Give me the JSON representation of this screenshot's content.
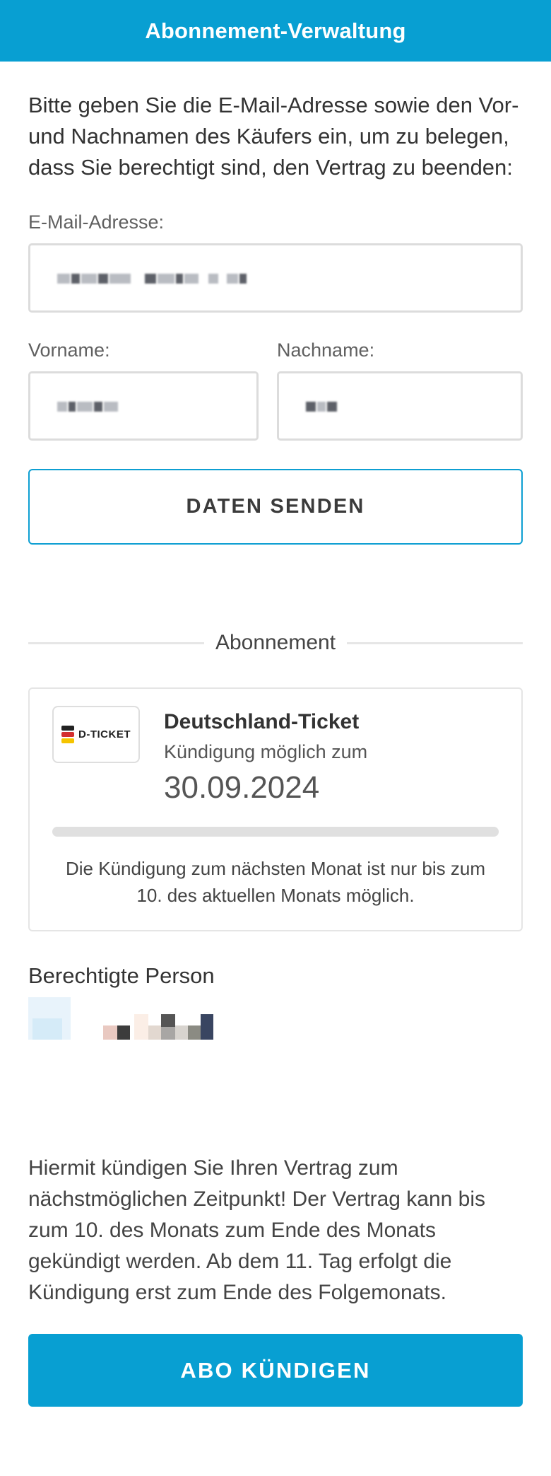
{
  "header": {
    "title": "Abonnement-Verwaltung"
  },
  "intro": "Bitte geben Sie die E-Mail-Adresse sowie den Vor- und Nachnamen des Käufers ein, um zu belegen, dass Sie berechtigt sind, den Vertrag zu beenden:",
  "form": {
    "email_label": "E-Mail-Adresse:",
    "firstname_label": "Vorname:",
    "lastname_label": "Nachname:",
    "submit_label": "DATEN SENDEN"
  },
  "subscription": {
    "section_label": "Abonnement",
    "logo_text": "D-TICKET",
    "logo_colors": [
      "#222222",
      "#d32f2f",
      "#f5c400"
    ],
    "title": "Deutschland-Ticket",
    "cancel_possible_label": "Kündigung möglich zum",
    "cancel_date": "30.09.2024",
    "progress_fraction": 0,
    "note": "Die Kündigung zum nächsten Monat ist nur bis zum 10. des aktuellen Monats möglich."
  },
  "person": {
    "title": "Berechtigte Person"
  },
  "final_text": "Hiermit kündigen Sie Ihren Vertrag zum nächstmöglichen Zeitpunkt! Der Vertrag kann bis zum 10. des Monats zum Ende des Monats gekündigt werden. Ab dem 11. Tag erfolgt die Kündigung erst zum Ende des Folgemonats.",
  "cancel_button": "ABO KÜNDIGEN",
  "colors": {
    "accent": "#089fd2",
    "border": "#dcdcdc"
  }
}
